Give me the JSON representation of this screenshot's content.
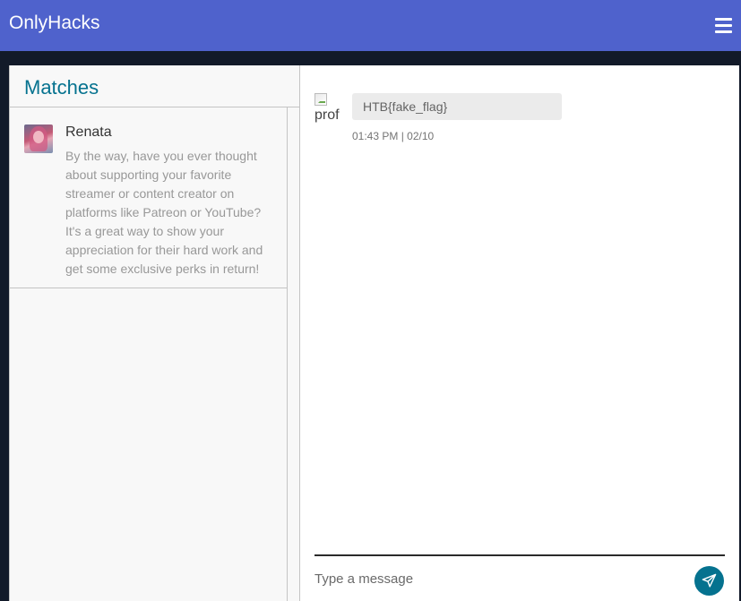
{
  "navbar": {
    "brand": "OnlyHacks",
    "menu_icon": "hamburger-menu-icon"
  },
  "sidebar": {
    "title": "Matches",
    "chats": [
      {
        "name": "Renata",
        "preview": "By the way, have you ever thought about supporting your favorite streamer or content creator on platforms like Patreon or YouTube? It's a great way to show your appreciation for their hard work and get some exclusive perks in return!",
        "avatar_icon": "user-avatar"
      }
    ]
  },
  "conversation": {
    "messages": [
      {
        "avatar_alt": "prof",
        "text": "HTB{fake_flag}",
        "time": "01:43 PM | 02/10"
      }
    ],
    "input": {
      "placeholder": "Type a message",
      "value": ""
    },
    "send_icon": "paper-plane-icon"
  },
  "colors": {
    "navbar_bg": "#4f62cc",
    "accent": "#05728f",
    "page_bg": "#121a29",
    "bubble_bg": "#ebebeb"
  }
}
